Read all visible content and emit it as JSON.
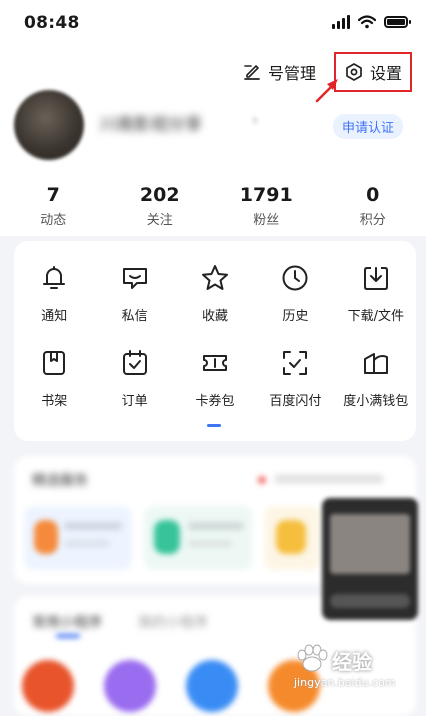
{
  "status_bar": {
    "time": "08:48"
  },
  "top_actions": {
    "account_label": "号管理",
    "settings_label": "设置"
  },
  "profile": {
    "nickname": "川南影视分享",
    "certify_label": "申请认证"
  },
  "stats": [
    {
      "value": "7",
      "label": "动态"
    },
    {
      "value": "202",
      "label": "关注"
    },
    {
      "value": "1791",
      "label": "粉丝"
    },
    {
      "value": "0",
      "label": "积分"
    }
  ],
  "services": [
    {
      "label": "通知",
      "icon": "bell-icon"
    },
    {
      "label": "私信",
      "icon": "message-icon"
    },
    {
      "label": "收藏",
      "icon": "star-icon"
    },
    {
      "label": "历史",
      "icon": "clock-icon"
    },
    {
      "label": "下载/文件",
      "icon": "download-icon"
    },
    {
      "label": "书架",
      "icon": "bookshelf-icon"
    },
    {
      "label": "订单",
      "icon": "order-icon"
    },
    {
      "label": "卡券包",
      "icon": "coupon-icon"
    },
    {
      "label": "百度闪付",
      "icon": "scan-pay-icon"
    },
    {
      "label": "度小满钱包",
      "icon": "wallet-icon"
    }
  ],
  "blurred": {
    "section1_title": "精选服务",
    "section2_title": "常用小程序",
    "section2_tab": "我的小程序"
  },
  "watermark": {
    "brand": "经验",
    "url": "jingyan.baidu.com"
  },
  "colors": {
    "accent": "#3f74f5",
    "highlight": "#e0262a"
  }
}
